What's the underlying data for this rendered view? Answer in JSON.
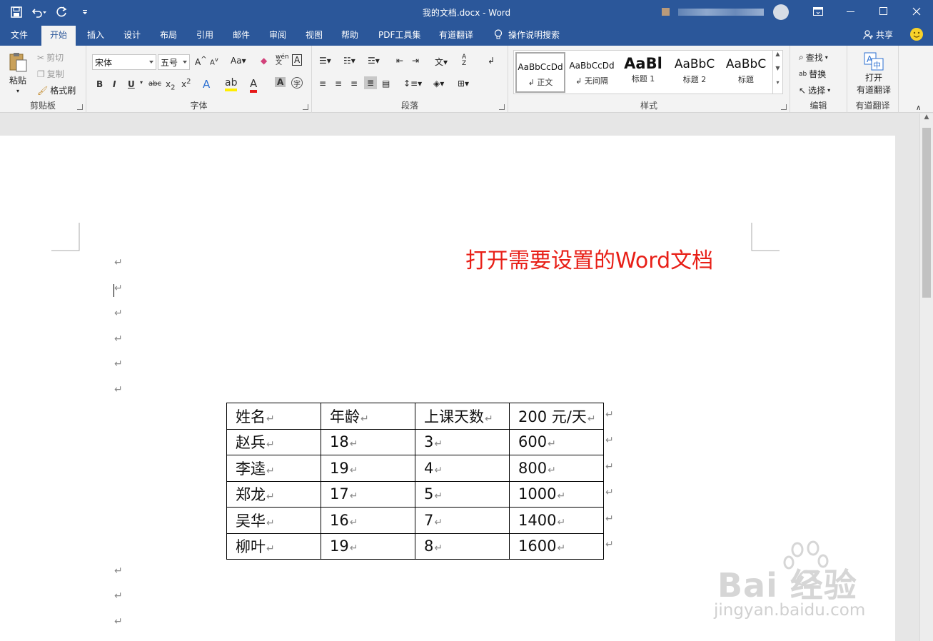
{
  "titlebar": {
    "title": "我的文档.docx  -  Word",
    "bg_color": "#2b579a"
  },
  "tabs": [
    "文件",
    "开始",
    "插入",
    "设计",
    "布局",
    "引用",
    "邮件",
    "审阅",
    "视图",
    "帮助",
    "PDF工具集",
    "有道翻译",
    "操作说明搜索"
  ],
  "active_tab": "开始",
  "share_label": "共享",
  "ribbon": {
    "clipboard": {
      "label": "剪贴板",
      "paste": "粘贴",
      "cut": "剪切",
      "copy": "复制",
      "format_painter": "格式刷"
    },
    "font": {
      "label": "字体",
      "font_name": "宋体",
      "font_size": "五号"
    },
    "paragraph": {
      "label": "段落"
    },
    "styles": {
      "label": "样式",
      "tiles": [
        {
          "sample": "AaBbCcDd",
          "name": "↲ 正文"
        },
        {
          "sample": "AaBbCcDd",
          "name": "↲ 无间隔"
        },
        {
          "sample": "AaBl",
          "name": "标题 1"
        },
        {
          "sample": "AaBbC",
          "name": "标题 2"
        },
        {
          "sample": "AaBbC",
          "name": "标题"
        }
      ]
    },
    "editing": {
      "label": "编辑",
      "find": "查找",
      "replace": "替换",
      "select": "选择"
    },
    "youdao": {
      "label": "有道翻译",
      "open_line1": "打开",
      "open_line2": "有道翻译"
    }
  },
  "document": {
    "headline": "打开需要设置的Word文档",
    "headline_color": "#e81f17",
    "table": {
      "headers": [
        "姓名",
        "年龄",
        "上课天数",
        "200 元/天"
      ],
      "rows": [
        [
          "赵兵",
          "18",
          "3",
          "600"
        ],
        [
          "李逵",
          "19",
          "4",
          "800"
        ],
        [
          "郑龙",
          "17",
          "5",
          "1000"
        ],
        [
          "吴华",
          "16",
          "7",
          "1400"
        ],
        [
          "柳叶",
          "19",
          "8",
          "1600"
        ]
      ]
    }
  },
  "watermark": {
    "brand": "Bai 经验",
    "url": "jingyan.baidu.com"
  }
}
